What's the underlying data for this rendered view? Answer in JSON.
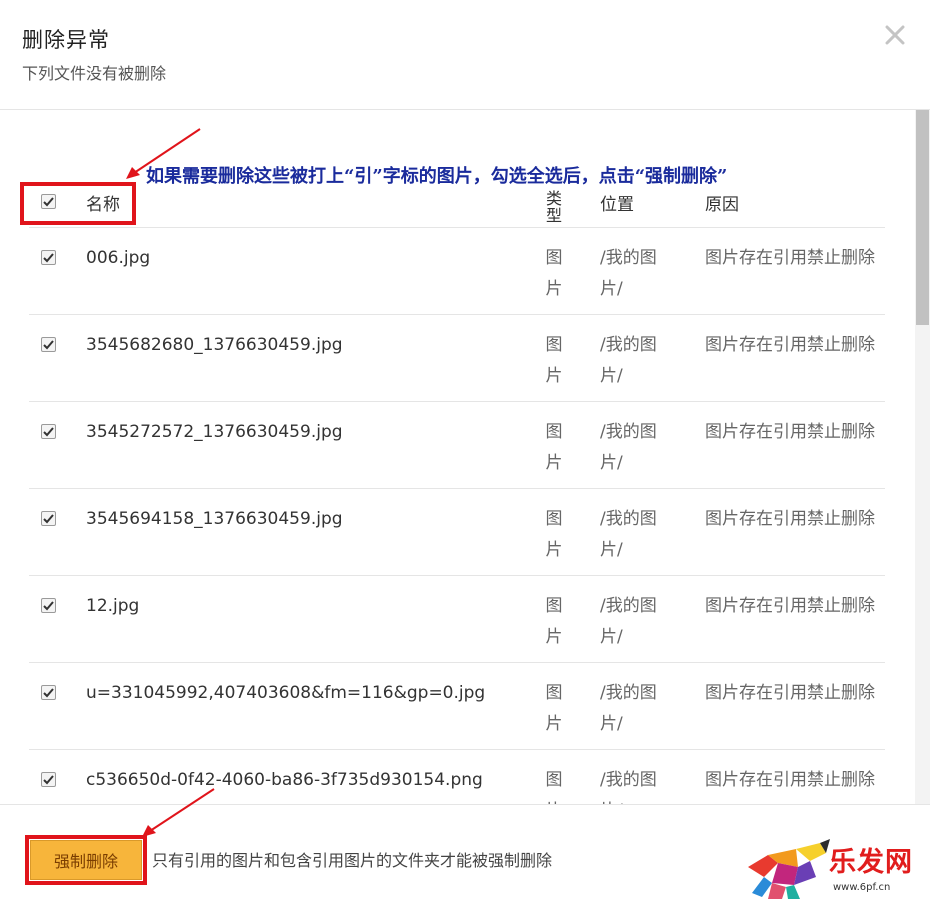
{
  "dialog": {
    "title": "删除异常",
    "subtitle": "下列文件没有被删除",
    "close_glyph": "✕"
  },
  "annotation_top": "如果需要删除这些被打上“引”字标的图片，勾选全选后，点击“强制删除”",
  "table": {
    "headers": {
      "name": "名称",
      "type": "类型",
      "location": "位置",
      "reason": "原因"
    },
    "rows": [
      {
        "name": "006.jpg",
        "type": "图片",
        "location": "/我的图片/",
        "reason": "图片存在引用禁止删除",
        "checked": true
      },
      {
        "name": "3545682680_1376630459.jpg",
        "type": "图片",
        "location": "/我的图片/",
        "reason": "图片存在引用禁止删除",
        "checked": true
      },
      {
        "name": "3545272572_1376630459.jpg",
        "type": "图片",
        "location": "/我的图片/",
        "reason": "图片存在引用禁止删除",
        "checked": true
      },
      {
        "name": "3545694158_1376630459.jpg",
        "type": "图片",
        "location": "/我的图片/",
        "reason": "图片存在引用禁止删除",
        "checked": true
      },
      {
        "name": "12.jpg",
        "type": "图片",
        "location": "/我的图片/",
        "reason": "图片存在引用禁止删除",
        "checked": true
      },
      {
        "name": "u=331045992,407403608&fm=116&gp=0.jpg",
        "type": "图片",
        "location": "/我的图片/",
        "reason": "图片存在引用禁止删除",
        "checked": true
      },
      {
        "name": "c536650d-0f42-4060-ba86-3f735d930154.png",
        "type": "图片",
        "location": "/我的图片/",
        "reason": "图片存在引用禁止删除",
        "checked": true
      }
    ]
  },
  "footer": {
    "force_delete_label": "强制删除",
    "note": "只有引用的图片和包含引用图片的文件夹才能被强制删除"
  },
  "watermark": {
    "text": "乐发网",
    "url": "www.6pf.cn"
  },
  "colors": {
    "annotation": "#1a2b9c",
    "highlight": "#e0141b",
    "force_button": "#f7b53b"
  }
}
